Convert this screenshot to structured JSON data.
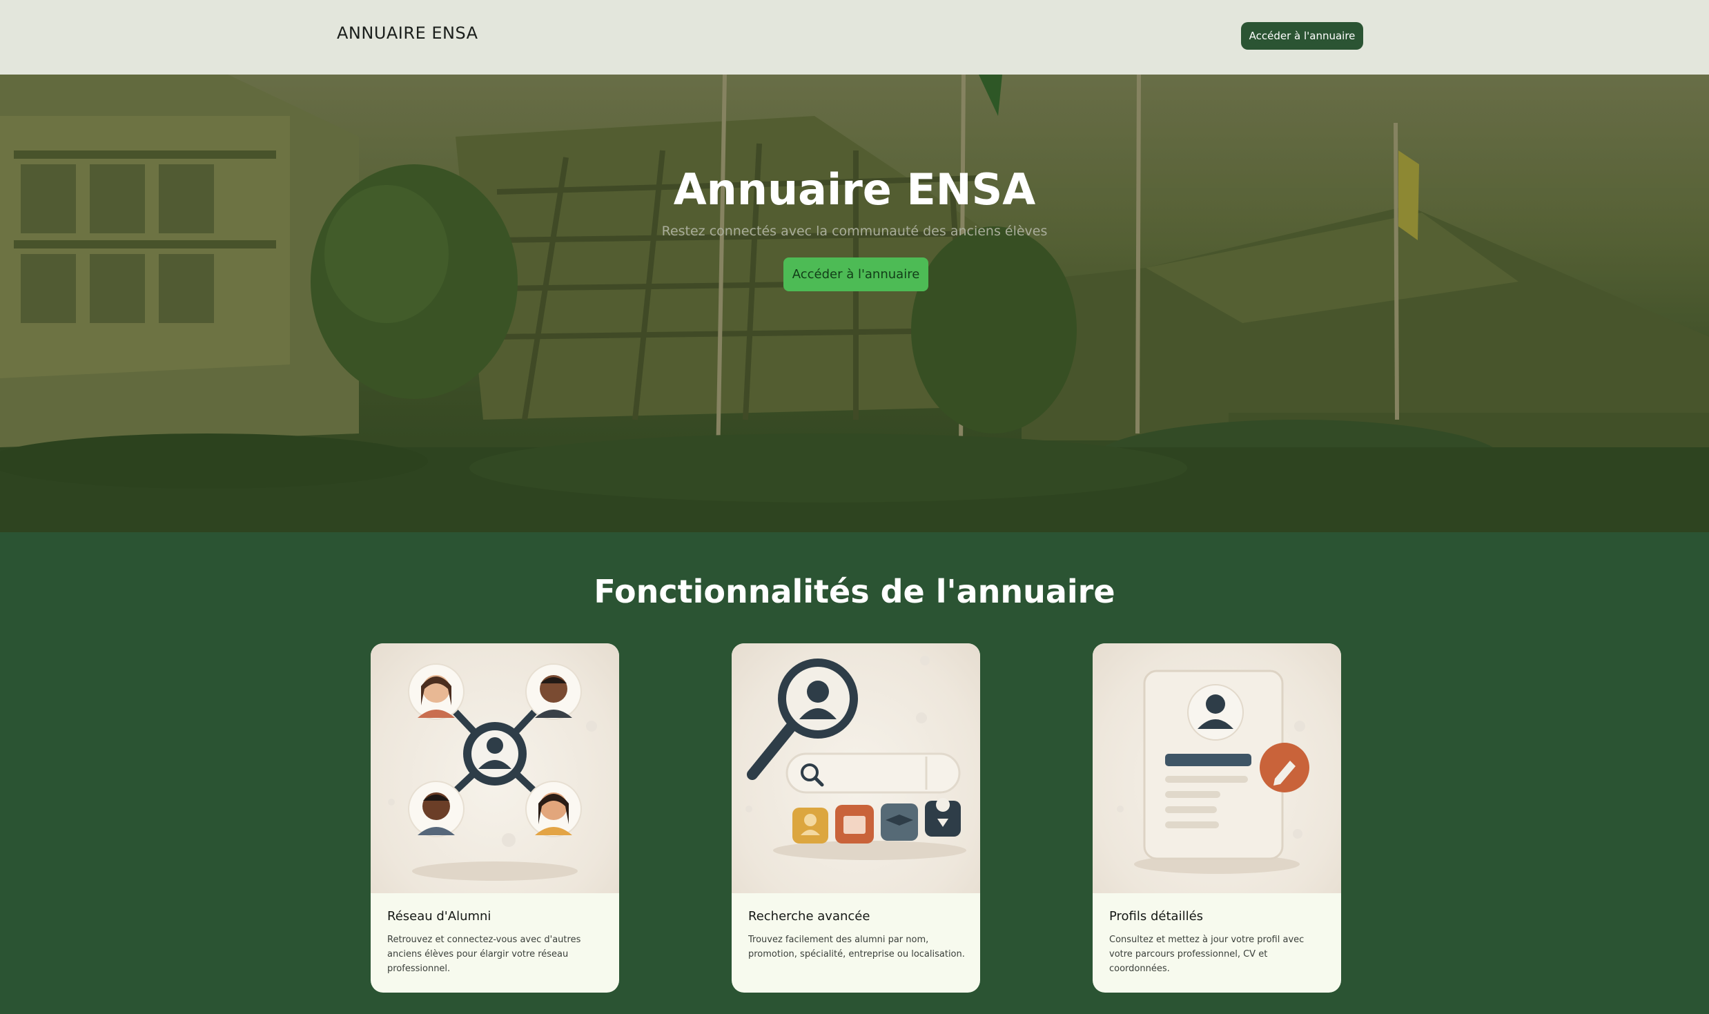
{
  "header": {
    "brand": "ANNUAIRE ENSA",
    "cta_label": "Accéder à l'annuaire"
  },
  "hero": {
    "title": "Annuaire ENSA",
    "subtitle": "Restez connectés avec la communauté des anciens élèves",
    "cta_label": "Accéder à l'annuaire"
  },
  "features": {
    "title": "Fonctionnalités de l'annuaire",
    "cards": [
      {
        "title": "Réseau d'Alumni",
        "description": "Retrouvez et connectez-vous avec d'autres anciens élèves pour élargir votre réseau professionnel.",
        "illustration": "alumni-network-illustration"
      },
      {
        "title": "Recherche avancée",
        "description": "Trouvez facilement des alumni par nom, promotion, spécialité, entreprise ou localisation.",
        "illustration": "advanced-search-illustration"
      },
      {
        "title": "Profils détaillés",
        "description": "Consultez et mettez à jour votre profil avec votre parcours professionnel, CV et coordonnées.",
        "illustration": "detailed-profile-illustration"
      }
    ]
  },
  "colors": {
    "header_bg": "#e3e6dc",
    "primary_green": "#2b5433",
    "hero_button": "#4dbb55",
    "card_bg": "#f7faee"
  }
}
